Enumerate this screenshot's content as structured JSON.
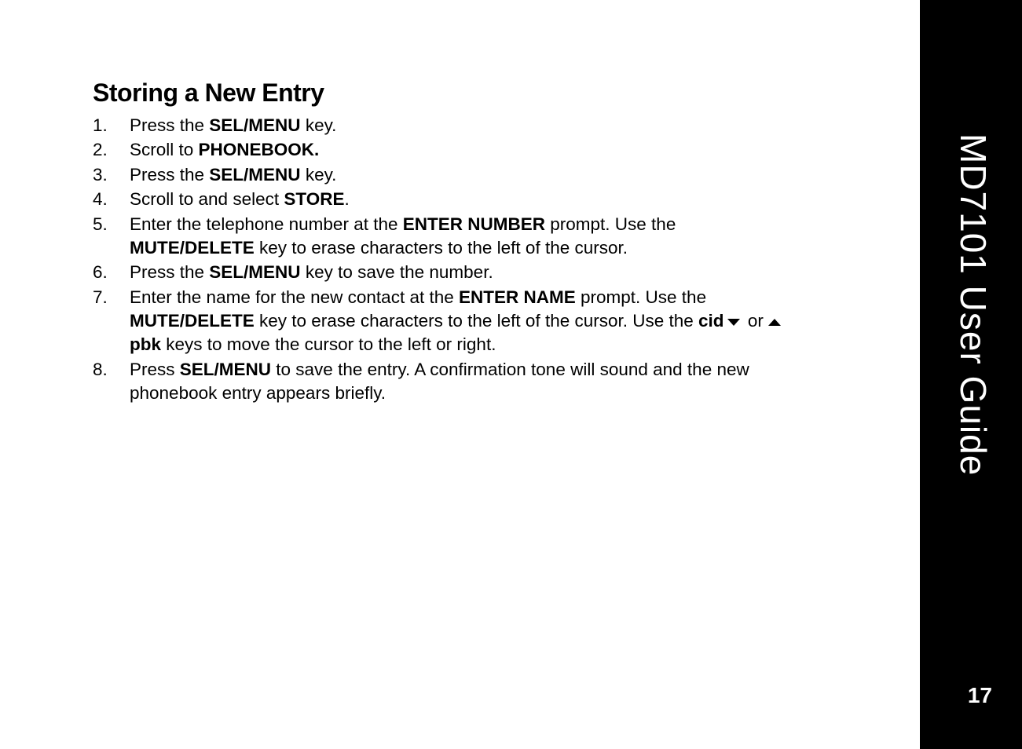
{
  "sidebar": {
    "title": "MD7101 User Guide",
    "page_number": "17"
  },
  "heading": "Storing a New Entry",
  "steps": [
    {
      "num": "1.",
      "parts": [
        {
          "t": "Press the "
        },
        {
          "t": "SEL/MENU",
          "b": true
        },
        {
          "t": " key."
        }
      ]
    },
    {
      "num": "2.",
      "parts": [
        {
          "t": "Scroll to "
        },
        {
          "t": "PHONEBOOK.",
          "b": true
        }
      ]
    },
    {
      "num": "3.",
      "parts": [
        {
          "t": "Press the "
        },
        {
          "t": "SEL/MENU",
          "b": true
        },
        {
          "t": " key."
        }
      ]
    },
    {
      "num": "4.",
      "parts": [
        {
          "t": "Scroll to and select "
        },
        {
          "t": "STORE",
          "b": true
        },
        {
          "t": "."
        }
      ]
    },
    {
      "num": "5.",
      "parts": [
        {
          "t": "Enter the telephone number at the "
        },
        {
          "t": "ENTER NUMBER",
          "b": true
        },
        {
          "t": " prompt. Use the "
        },
        {
          "t": "MUTE/DELETE",
          "b": true
        },
        {
          "t": " key to erase characters to the left of the cursor."
        }
      ]
    },
    {
      "num": "6.",
      "parts": [
        {
          "t": "Press the "
        },
        {
          "t": "SEL/MENU",
          "b": true
        },
        {
          "t": " key to save the number."
        }
      ]
    },
    {
      "num": "7.",
      "parts": [
        {
          "t": "Enter the name for the new contact at the "
        },
        {
          "t": "ENTER NAME",
          "b": true
        },
        {
          "t": " prompt. Use the "
        },
        {
          "t": "MUTE/DELETE",
          "b": true
        },
        {
          "t": " key to erase characters to the left of the cursor. Use the "
        },
        {
          "t": "cid",
          "b": true
        },
        {
          "icon": "down"
        },
        {
          "t": " or "
        },
        {
          "icon": "up"
        },
        {
          "t": "pbk",
          "b": true
        },
        {
          "t": " keys to move the cursor to the left or right."
        }
      ]
    },
    {
      "num": "8.",
      "parts": [
        {
          "t": "Press "
        },
        {
          "t": "SEL/MENU",
          "b": true
        },
        {
          "t": " to save the entry. A confirmation tone will sound and the new phonebook entry appears briefly."
        }
      ]
    }
  ]
}
